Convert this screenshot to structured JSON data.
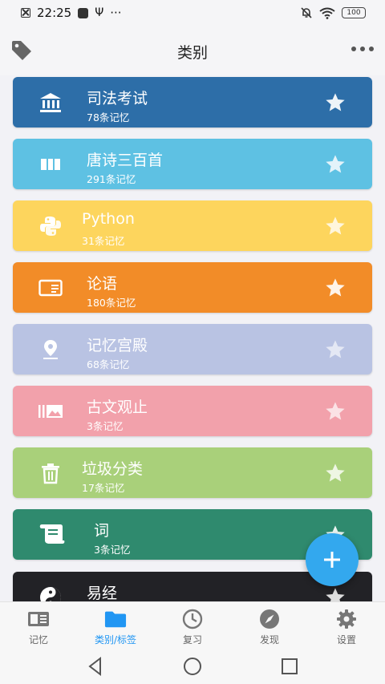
{
  "status_bar": {
    "time": "22:25",
    "more": "···",
    "battery": "100"
  },
  "app_bar": {
    "title": "类别",
    "left_icon": "tag-icon",
    "right_icon": "more-icon"
  },
  "categories": [
    {
      "name": "司法考试",
      "count": "78条记忆",
      "color": "#2d6ea8",
      "icon": "bank-icon",
      "star_color": "#ffffff"
    },
    {
      "name": "唐诗三百首",
      "count": "291条记忆",
      "color": "#5ec1e3",
      "icon": "columns-icon",
      "star_color": "#ffffff"
    },
    {
      "name": "Python",
      "count": "31条记忆",
      "color": "#fdd55d",
      "icon": "python-icon",
      "star_color": "#ffffff"
    },
    {
      "name": "论语",
      "count": "180条记忆",
      "color": "#f28c28",
      "icon": "card-icon",
      "star_color": "#ffffff"
    },
    {
      "name": "记忆宫殿",
      "count": "68条记忆",
      "color": "#b9c3e3",
      "icon": "location-pin-icon",
      "star_color": "#ffffff"
    },
    {
      "name": "古文观止",
      "count": "3条记忆",
      "color": "#f2a1ab",
      "icon": "gallery-icon",
      "star_color": "#ffffff"
    },
    {
      "name": "垃圾分类",
      "count": "17条记忆",
      "color": "#a9d07a",
      "icon": "trash-icon",
      "star_color": "#ffffff"
    },
    {
      "name": "词",
      "count": "3条记忆",
      "color": "#2f8a6e",
      "icon": "scroll-icon",
      "star_color": "#ffffff"
    },
    {
      "name": "易经",
      "count": "",
      "color": "#222226",
      "icon": "yin-yang-icon",
      "star_color": "#ffffff"
    }
  ],
  "fab": {
    "icon": "plus-icon"
  },
  "bottom_nav": [
    {
      "label": "记忆",
      "icon": "memory-card-icon",
      "active": false
    },
    {
      "label": "类别/标签",
      "icon": "folder-icon",
      "active": true
    },
    {
      "label": "复习",
      "icon": "clock-icon",
      "active": false
    },
    {
      "label": "发现",
      "icon": "compass-icon",
      "active": false
    },
    {
      "label": "设置",
      "icon": "gear-icon",
      "active": false
    }
  ],
  "system_nav": [
    "back-icon",
    "home-icon",
    "recents-icon"
  ]
}
